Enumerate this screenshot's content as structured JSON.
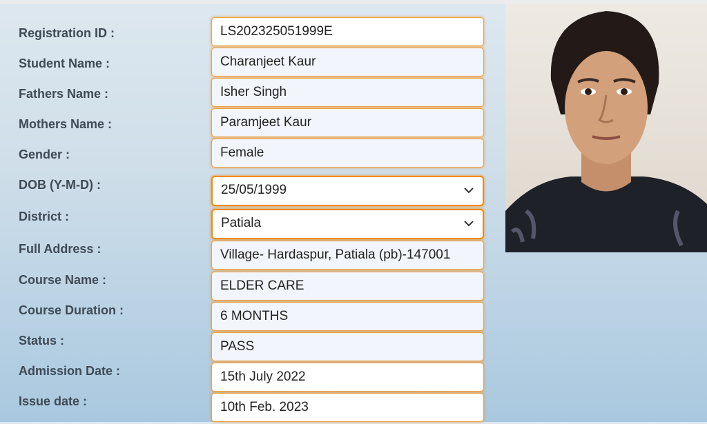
{
  "form": {
    "rows": [
      {
        "label": "Registration ID :",
        "value": "LS202325051999E"
      },
      {
        "label": "Student Name :",
        "value": "Charanjeet Kaur"
      },
      {
        "label": "Fathers Name :",
        "value": "Isher Singh"
      },
      {
        "label": "Mothers Name :",
        "value": "Paramjeet Kaur"
      },
      {
        "label": "Gender :",
        "value": "Female"
      },
      {
        "label": "DOB (Y-M-D) :",
        "value": "25/05/1999"
      },
      {
        "label": "District :",
        "value": "Patiala"
      },
      {
        "label": "Full Address :",
        "value": "Village- Hardaspur, Patiala (pb)-147001"
      },
      {
        "label": "Course Name :",
        "value": "ELDER CARE"
      },
      {
        "label": "Course Duration :",
        "value": "6 MONTHS"
      },
      {
        "label": "Status :",
        "value": "PASS"
      },
      {
        "label": "Admission Date :",
        "value": "15th July 2022"
      },
      {
        "label": "Issue date :",
        "value": "10th Feb. 2023"
      }
    ]
  },
  "icons": {
    "select_arrow": "chevron-down-icon",
    "photo": "student-photo"
  },
  "colors": {
    "field_border": "#f0a040",
    "select_border": "#f08a10",
    "label_text": "#3f4a55"
  }
}
